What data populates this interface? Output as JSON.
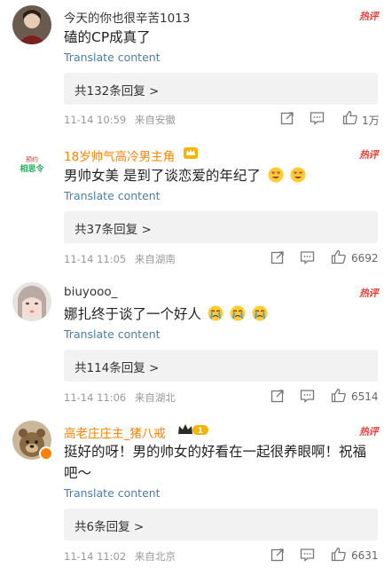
{
  "comments": [
    {
      "username": "今天的你也很辛苦1013",
      "hot": "热评",
      "text": "磕的CP成真了",
      "translate": "Translate content",
      "replies": "共132条回复 >",
      "time": "11-14 10:59",
      "location": "来自安徽",
      "likes": "1万"
    },
    {
      "username": "18岁帅气高冷男主角",
      "avatar_text": "预约\n相思令",
      "hot": "热评",
      "text": "男帅女美 是到了谈恋爱的年纪了",
      "translate": "Translate content",
      "replies": "共37条回复 >",
      "time": "11-14 11:05",
      "location": "来自湖南",
      "likes": "6692"
    },
    {
      "username": "biuyooo_",
      "hot": "热评",
      "text": "娜扎终于谈了一个好人",
      "translate": "Translate content",
      "replies": "共114条回复 >",
      "time": "11-14 11:06",
      "location": "来自湖北",
      "likes": "6514"
    },
    {
      "username": "高老庄庄主_猪八戒",
      "hot": "热评",
      "text": "挺好的呀！男的帅女的好看在一起很养眼啊！祝福吧～",
      "translate": "Translate content",
      "replies": "共6条回复 >",
      "time": "11-14 11:02",
      "location": "来自北京",
      "likes": "6631"
    }
  ],
  "colors": {
    "vip_name": "#ff8200",
    "translate_link": "#4a7ea8",
    "hot_label": "#e8403a",
    "meta_text": "#999999"
  },
  "icons": [
    "share-icon",
    "comment-icon",
    "like-icon",
    "heart-eyes-emoji",
    "crying-emoji",
    "crown-icon"
  ]
}
